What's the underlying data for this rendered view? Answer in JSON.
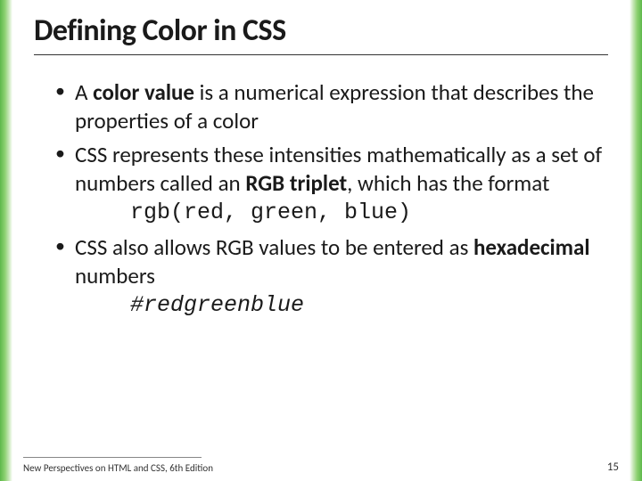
{
  "title": "Defining Color in CSS",
  "bullets": {
    "b1_pre": "A ",
    "b1_bold": "color value",
    "b1_post": " is a numerical expression that describes the properties of a color",
    "b2_pre": "CSS represents these intensities mathematically as a set of numbers called an ",
    "b2_bold": "RGB triplet",
    "b2_post": ", which has the format",
    "b2_code": "rgb(red, green, blue)",
    "b3_pre": "CSS also allows RGB values to be entered as ",
    "b3_bold": "hexadecimal",
    "b3_post": " numbers",
    "b3_code": "#redgreenblue"
  },
  "footer": {
    "text": "New Perspectives on HTML and CSS, 6th Edition",
    "page": "15"
  }
}
